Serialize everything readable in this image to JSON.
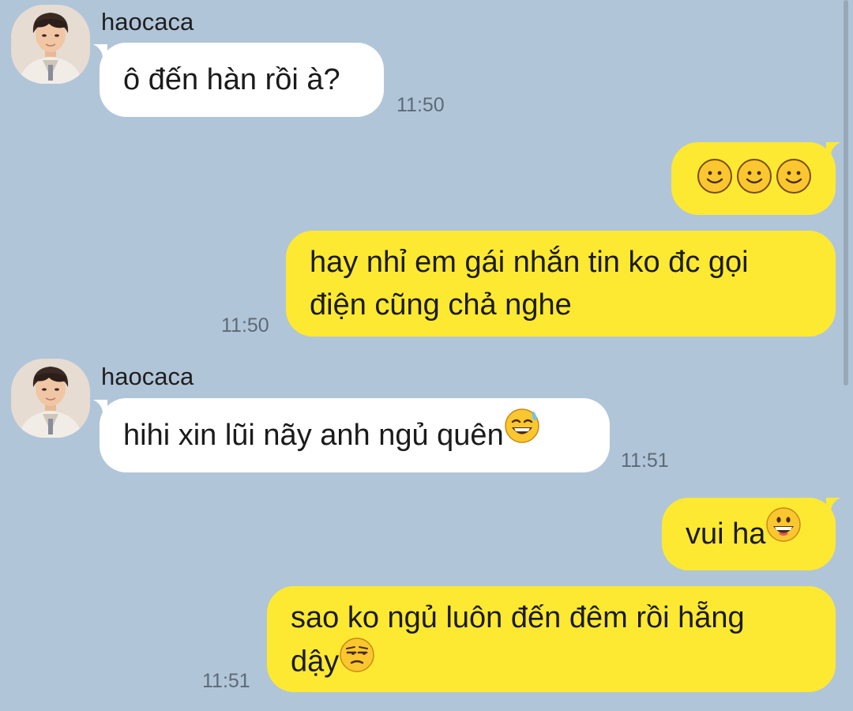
{
  "conversation": {
    "messages": [
      {
        "side": "in",
        "sender": "haocaca",
        "text": "ô đến hàn rồi à?",
        "time": "11:50"
      },
      {
        "side": "out",
        "emoji": [
          "smile-icon",
          "smile-icon",
          "smile-icon"
        ]
      },
      {
        "side": "out",
        "line1": "hay nhỉ em gái nhắn tin ko đc gọi",
        "line2": "điện cũng chả nghe",
        "time": "11:50"
      },
      {
        "side": "in",
        "sender": "haocaca",
        "text": "hihi xin lũi nãy anh ngủ quên",
        "emoji": "sweat-smile-icon",
        "time": "11:51"
      },
      {
        "side": "out",
        "text": "vui ha",
        "emoji": "grin-icon"
      },
      {
        "side": "out",
        "line1": "sao ko ngủ luôn đến đêm rồi hẵng",
        "line2": "dậy",
        "emoji": "unamused-icon",
        "time": "11:51"
      }
    ]
  },
  "colors": {
    "background": "#b1c5d9",
    "incoming_bubble": "#ffffff",
    "outgoing_bubble": "#fde932",
    "timestamp": "#5d6a76"
  }
}
